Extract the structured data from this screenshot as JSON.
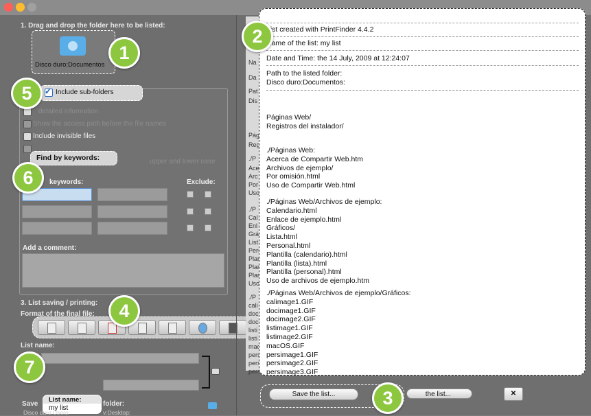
{
  "sections": {
    "drag_title": "1. Drag and drop the folder here to be listed:",
    "saving_title": "3. List saving / printing:",
    "format_label": "Format of the final file:",
    "list_name_label": "List name:",
    "save_folder_label": "Save",
    "save_folder_label2": "folder:",
    "save_path": "Disco duro:Users:",
    "save_path2": "v:Desktop:"
  },
  "folder": {
    "label": "Disco duro:Documentos"
  },
  "options": {
    "include_subfolders": "Include sub-folders",
    "detailed_info": "detailed information",
    "access_path": "Show the access path before the file names",
    "invisible": "Include invisible files",
    "case": "upper and lower case"
  },
  "keywords": {
    "title": "Find by keywords:",
    "col_keywords": "keywords:",
    "col_exclude": "Exclude:"
  },
  "comment": {
    "label": "Add a comment:"
  },
  "list_name_popup": {
    "label": "List name:",
    "value": "my list"
  },
  "preview": {
    "lines": [
      "List created with PrintFinder 4.4.2",
      "Name of the list: my list",
      "Date and Time: the 14 July, 2009 at 12:24:07",
      "Path to the listed folder:",
      "Disco duro:Documentos:",
      "Páginas Web/",
      "Registros del instalador/",
      "./Páginas Web:",
      "Acerca de Compartir Web.htm",
      "Archivos de ejemplo/",
      "Por omisión.html",
      "Uso de Compartir Web.html",
      "./Páginas Web/Archivos de ejemplo:",
      "Calendario.html",
      "Enlace de ejemplo.html",
      "Gráficos/",
      "Lista.html",
      "Personal.html",
      "Plantilla (calendario).html",
      "Plantilla (lista).html",
      "Plantilla (personal).html",
      "Uso de archivos de ejemplo.htm",
      "./Páginas Web/Archivos de ejemplo/Gráficos:",
      "calimage1.GIF",
      "docimage1.GIF",
      "docimage2.GIF",
      "listimage1.GIF",
      "listimage2.GIF",
      "macOS.GIF",
      "persimage1.GIF",
      "persimage2.GIF",
      "persimage3.GIF"
    ]
  },
  "ghost_lines": [
    "Na",
    "Da",
    "Pat",
    "Dis",
    "Pág",
    "Reg",
    "./P",
    "Ace",
    "Arc",
    "Por",
    "Uso",
    "./P",
    "Cal",
    "Enl",
    "Grá",
    "List",
    "Pers",
    "Plan",
    "Plan",
    "Plan",
    "Uso",
    "./P",
    "cali",
    "doc",
    "doc",
    "listi",
    "listi",
    "mac",
    "pers",
    "pers",
    "pers"
  ],
  "buttons": {
    "save_list": "Save the list...",
    "print_list": "the list...",
    "close": "✕"
  },
  "toolbar_icons": [
    "text-file-icon",
    "document-icon",
    "pdf-icon",
    "table-icon",
    "spreadsheet-icon",
    "web-icon",
    "printer-icon"
  ],
  "badges": [
    "1",
    "2",
    "3",
    "4",
    "5",
    "6",
    "7"
  ],
  "colors": {
    "badge_green": "#8dc63f",
    "title_red": "#ff5f57"
  }
}
